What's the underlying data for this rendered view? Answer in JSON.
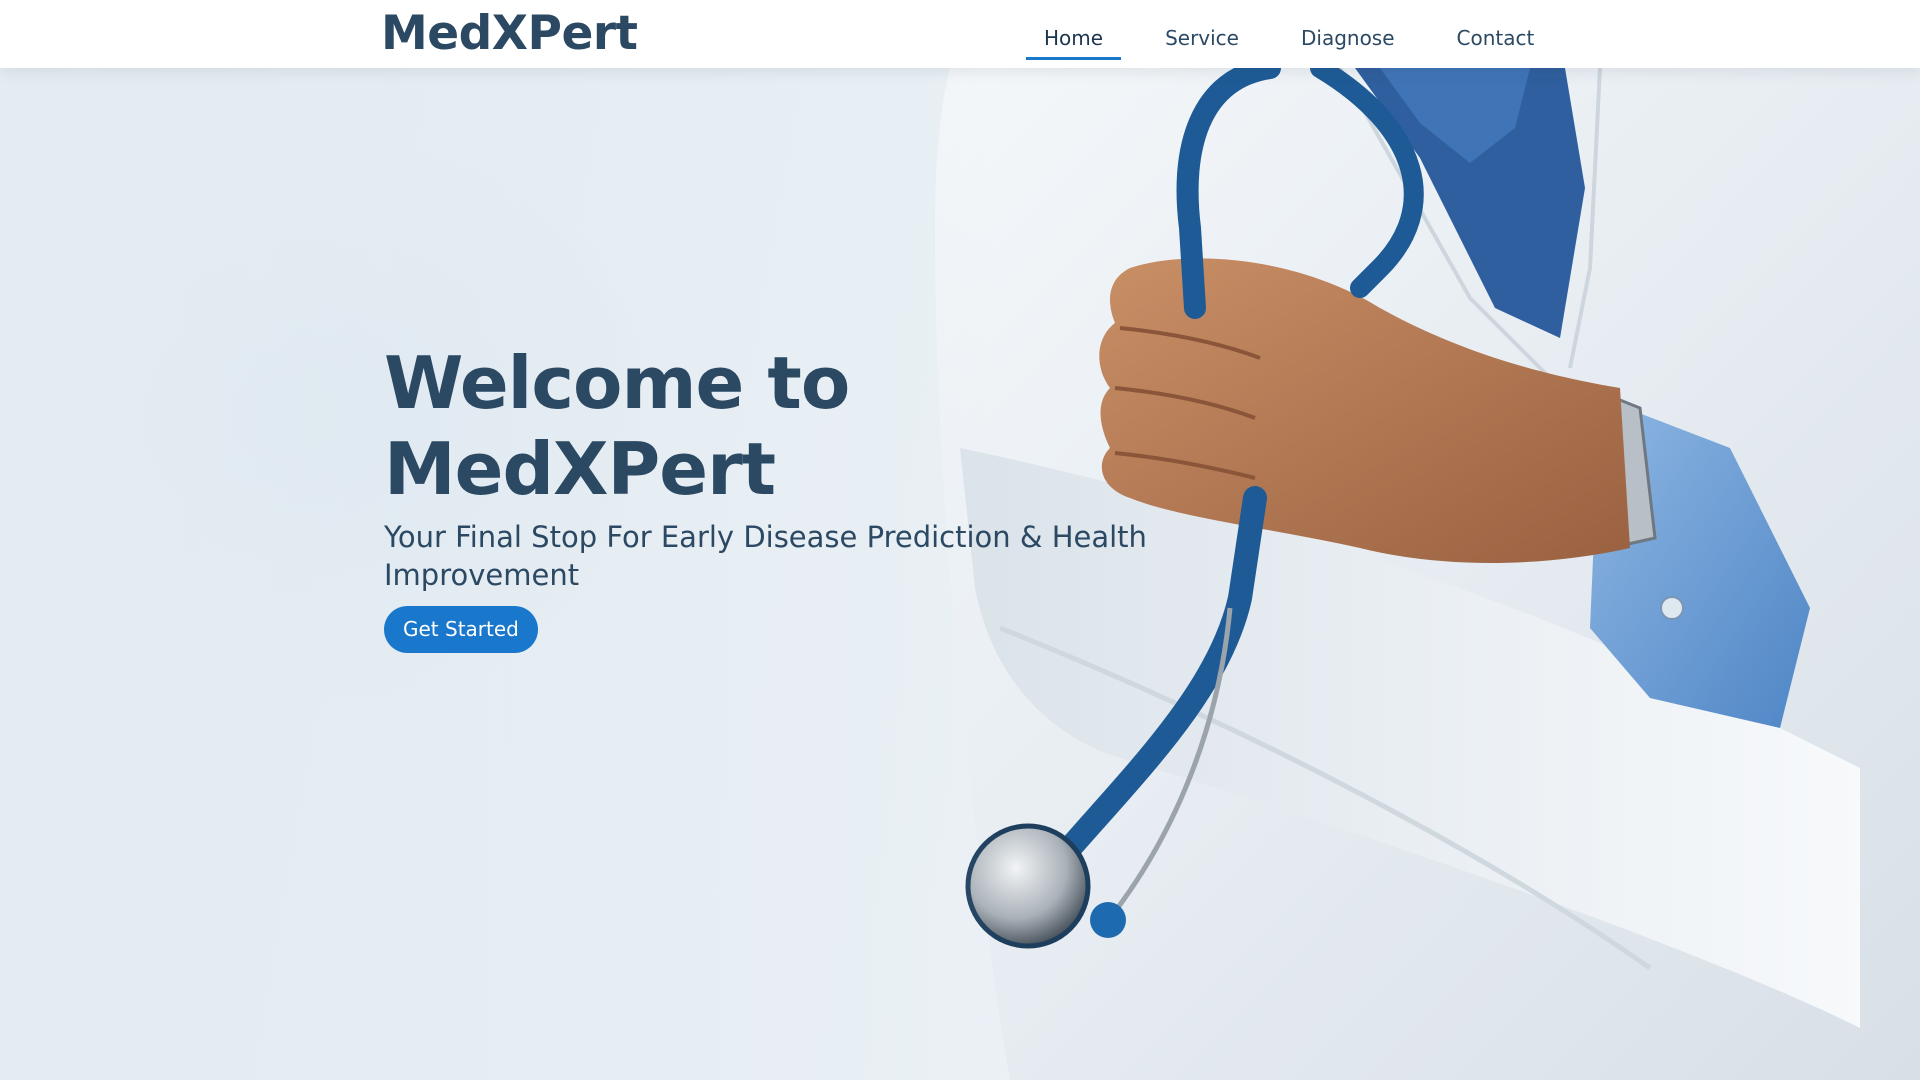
{
  "header": {
    "logo": "MedXPert",
    "nav": [
      {
        "label": "Home",
        "active": true
      },
      {
        "label": "Service",
        "active": false
      },
      {
        "label": "Diagnose",
        "active": false
      },
      {
        "label": "Contact",
        "active": false
      }
    ]
  },
  "hero": {
    "title": "Welcome to MedXPert",
    "subtitle": "Your Final Stop For Early Disease Prediction & Health Improvement",
    "cta_label": "Get Started",
    "image": "doctor-with-stethoscope-photo"
  },
  "colors": {
    "brand": "#2c4964",
    "accent": "#1977cc",
    "background": "#e3ebf1"
  }
}
